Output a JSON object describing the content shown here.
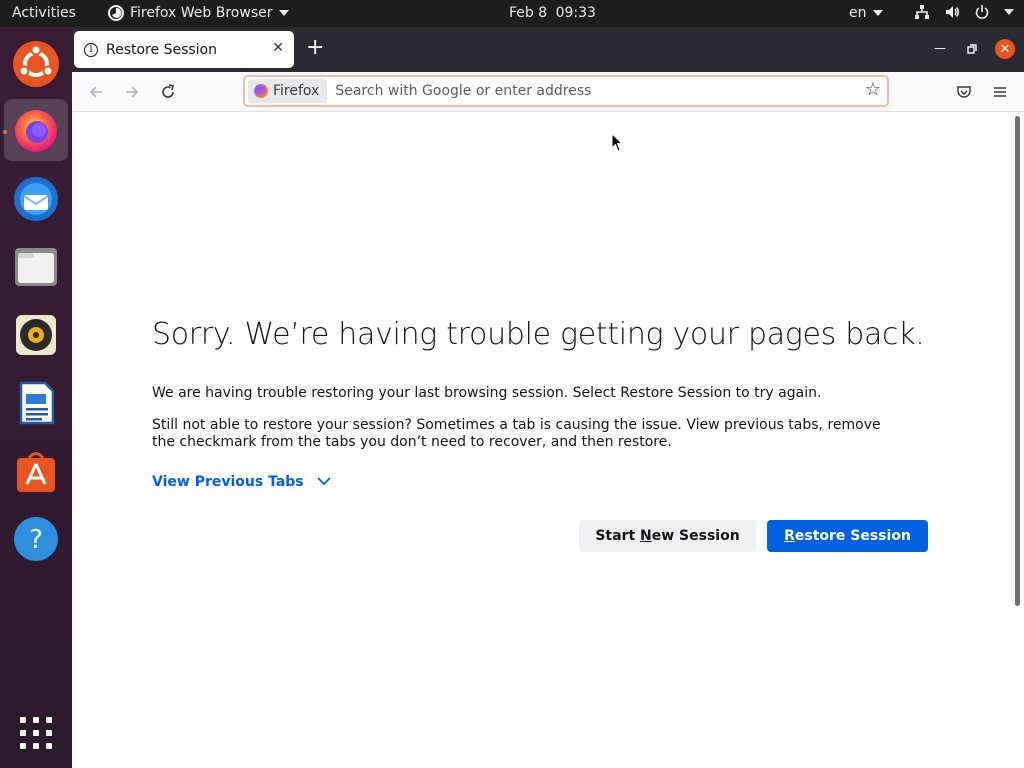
{
  "topbar": {
    "activities": "Activities",
    "app_name": "Firefox Web Browser",
    "date": "Feb 8",
    "time": "09:33",
    "lang": "en"
  },
  "dock": {
    "items": [
      "ubuntu-logo",
      "firefox",
      "thunderbird",
      "files",
      "rhythmbox",
      "libreoffice-writer",
      "ubuntu-software",
      "help",
      "show-applications"
    ]
  },
  "browser": {
    "tab_title": "Restore Session",
    "identity_label": "Firefox",
    "url_placeholder": "Search with Google or enter address"
  },
  "page": {
    "title": "Sorry. We’re having trouble getting your pages back.",
    "paragraph1": "We are having trouble restoring your last browsing session. Select Restore Session to try again.",
    "paragraph2": "Still not able to restore your session? Sometimes a tab is causing the issue. View previous tabs, remove the checkmark from the tabs you don’t need to recover, and then restore.",
    "view_previous_tabs": "View Previous Tabs",
    "start_new_prefix": "Start ",
    "start_new_key": "N",
    "start_new_suffix": "ew Session",
    "restore_key": "R",
    "restore_suffix": "estore Session"
  },
  "colors": {
    "accent": "#0061e0",
    "ubuntu_orange": "#e95420",
    "topbar": "#1d1d1d",
    "tabstrip": "#2b2a33"
  }
}
